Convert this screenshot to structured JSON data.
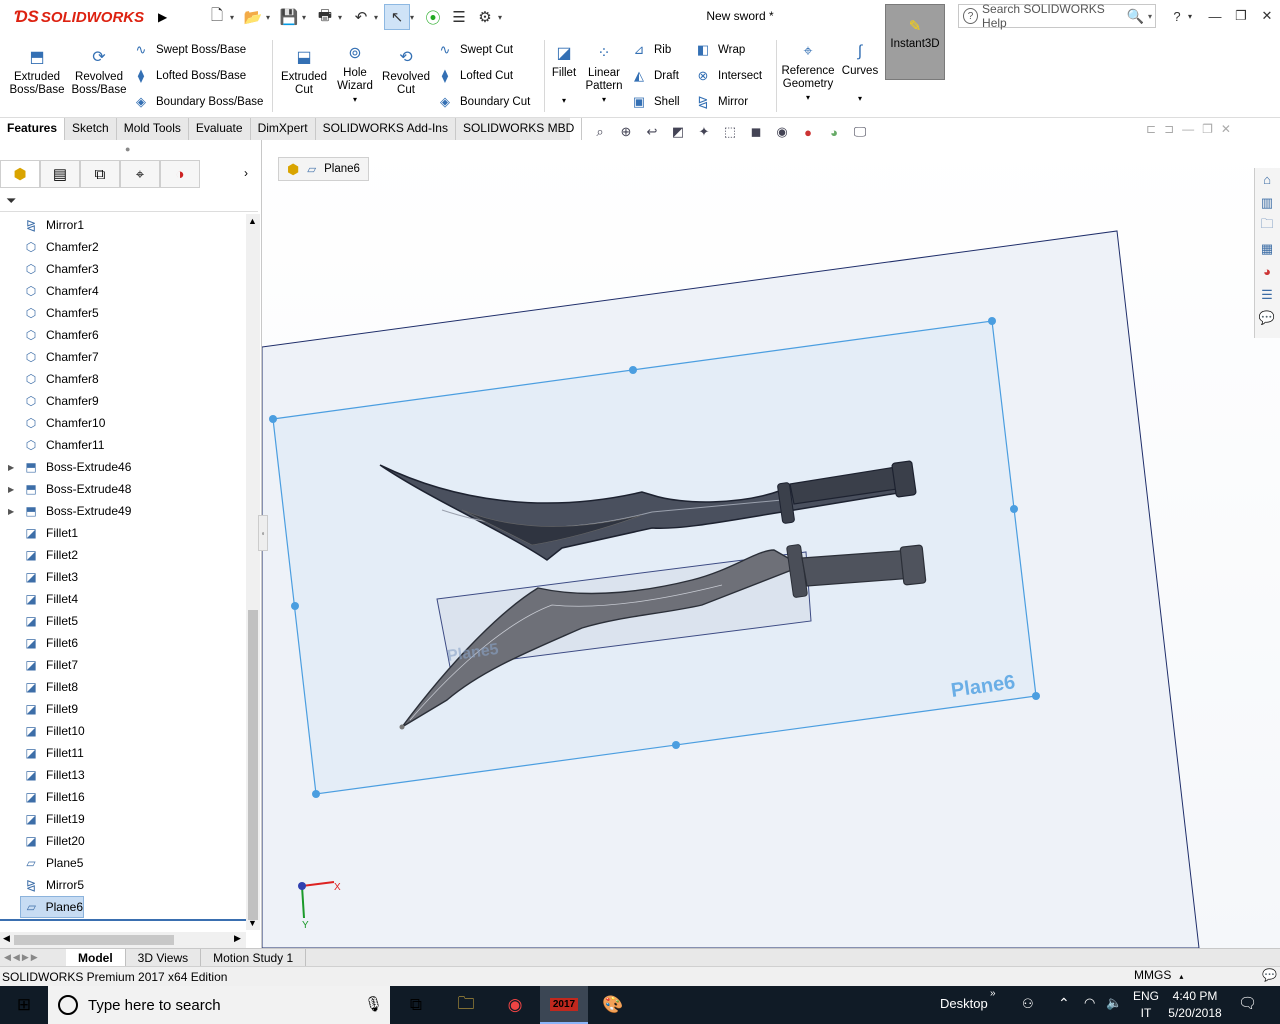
{
  "app": {
    "logo": "SOLIDWORKS",
    "doc_title": "New sword *",
    "search_placeholder": "Search SOLIDWORKS Help"
  },
  "ribbon": {
    "extruded_boss": "Extruded Boss/Base",
    "revolved_boss": "Revolved Boss/Base",
    "swept_boss": "Swept Boss/Base",
    "lofted_boss": "Lofted Boss/Base",
    "boundary_boss": "Boundary Boss/Base",
    "extruded_cut": "Extruded Cut",
    "hole_wizard": "Hole Wizard",
    "revolved_cut": "Revolved Cut",
    "swept_cut": "Swept Cut",
    "lofted_cut": "Lofted Cut",
    "boundary_cut": "Boundary Cut",
    "fillet": "Fillet",
    "linear_pattern": "Linear Pattern",
    "rib": "Rib",
    "draft": "Draft",
    "shell": "Shell",
    "wrap": "Wrap",
    "intersect": "Intersect",
    "mirror": "Mirror",
    "reference_geometry": "Reference Geometry",
    "curves": "Curves",
    "instant3d": "Instant3D"
  },
  "tabs": [
    "Features",
    "Sketch",
    "Mold Tools",
    "Evaluate",
    "DimXpert",
    "SOLIDWORKS Add-Ins",
    "SOLIDWORKS MBD"
  ],
  "breadcrumb": {
    "item": "Plane6"
  },
  "tree": [
    {
      "label": "Mirror1",
      "icon": "mirror-icon",
      "exp": false
    },
    {
      "label": "Chamfer2",
      "icon": "chamfer-icon",
      "exp": false
    },
    {
      "label": "Chamfer3",
      "icon": "chamfer-icon",
      "exp": false
    },
    {
      "label": "Chamfer4",
      "icon": "chamfer-icon",
      "exp": false
    },
    {
      "label": "Chamfer5",
      "icon": "chamfer-icon",
      "exp": false
    },
    {
      "label": "Chamfer6",
      "icon": "chamfer-icon",
      "exp": false
    },
    {
      "label": "Chamfer7",
      "icon": "chamfer-icon",
      "exp": false
    },
    {
      "label": "Chamfer8",
      "icon": "chamfer-icon",
      "exp": false
    },
    {
      "label": "Chamfer9",
      "icon": "chamfer-icon",
      "exp": false
    },
    {
      "label": "Chamfer10",
      "icon": "chamfer-icon",
      "exp": false
    },
    {
      "label": "Chamfer11",
      "icon": "chamfer-icon",
      "exp": false
    },
    {
      "label": "Boss-Extrude46",
      "icon": "extrude-icon",
      "exp": true
    },
    {
      "label": "Boss-Extrude48",
      "icon": "extrude-icon",
      "exp": true
    },
    {
      "label": "Boss-Extrude49",
      "icon": "extrude-icon",
      "exp": true
    },
    {
      "label": "Fillet1",
      "icon": "fillet-icon",
      "exp": false
    },
    {
      "label": "Fillet2",
      "icon": "fillet-icon",
      "exp": false
    },
    {
      "label": "Fillet3",
      "icon": "fillet-icon",
      "exp": false
    },
    {
      "label": "Fillet4",
      "icon": "fillet-icon",
      "exp": false
    },
    {
      "label": "Fillet5",
      "icon": "fillet-icon",
      "exp": false
    },
    {
      "label": "Fillet6",
      "icon": "fillet-icon",
      "exp": false
    },
    {
      "label": "Fillet7",
      "icon": "fillet-icon",
      "exp": false
    },
    {
      "label": "Fillet8",
      "icon": "fillet-icon",
      "exp": false
    },
    {
      "label": "Fillet9",
      "icon": "fillet-icon",
      "exp": false
    },
    {
      "label": "Fillet10",
      "icon": "fillet-icon",
      "exp": false
    },
    {
      "label": "Fillet11",
      "icon": "fillet-icon",
      "exp": false
    },
    {
      "label": "Fillet13",
      "icon": "fillet-icon",
      "exp": false
    },
    {
      "label": "Fillet16",
      "icon": "fillet-icon",
      "exp": false
    },
    {
      "label": "Fillet19",
      "icon": "fillet-icon",
      "exp": false
    },
    {
      "label": "Fillet20",
      "icon": "fillet-icon",
      "exp": false
    },
    {
      "label": "Plane5",
      "icon": "plane-icon",
      "exp": false
    },
    {
      "label": "Mirror5",
      "icon": "mirror-icon",
      "exp": false
    },
    {
      "label": "Plane6",
      "icon": "plane-icon",
      "exp": false,
      "selected": true
    }
  ],
  "viewport": {
    "plane_label": "Plane6",
    "plane_label_faint": "Plane5",
    "axis_x": "X",
    "axis_y": "Y"
  },
  "bottom_tabs": [
    "Model",
    "3D Views",
    "Motion Study 1"
  ],
  "status": {
    "edition": "SOLIDWORKS Premium 2017 x64 Edition",
    "units": "MMGS"
  },
  "taskbar": {
    "search_placeholder": "Type here to search",
    "desktop": "Desktop",
    "lang1": "ENG",
    "lang2": "IT",
    "time": "4:40 PM",
    "date": "5/20/2018",
    "sw_badge": "2017"
  },
  "colors": {
    "accent": "#3470b4",
    "plane_edge": "#4b9ee0",
    "taskbar": "#101b26",
    "sw_red": "#d21"
  }
}
